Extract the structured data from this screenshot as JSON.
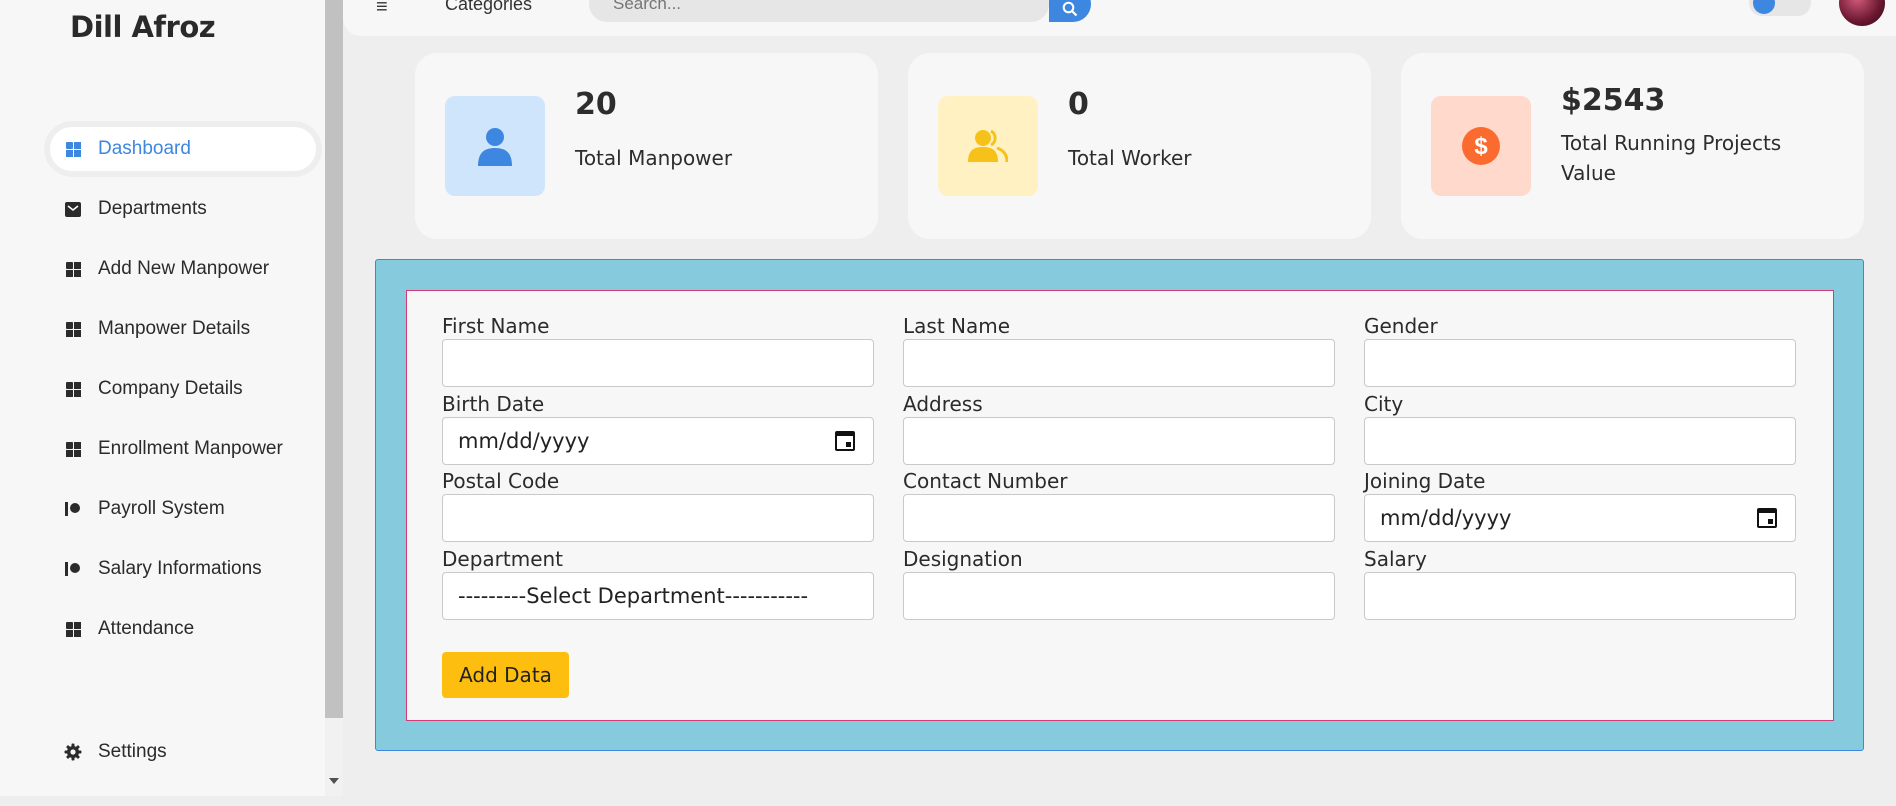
{
  "sidebar": {
    "brand": "Dill Afroz",
    "items": [
      {
        "label": "Dashboard",
        "icon": "dashboard-icon"
      },
      {
        "label": "Departments",
        "icon": "mail-icon"
      },
      {
        "label": "Add New Manpower",
        "icon": "grid-icon"
      },
      {
        "label": "Manpower Details",
        "icon": "grid-icon"
      },
      {
        "label": "Company Details",
        "icon": "grid-icon"
      },
      {
        "label": "Enrollment Manpower",
        "icon": "grid-icon"
      },
      {
        "label": "Payroll System",
        "icon": "toggle-icon"
      },
      {
        "label": "Salary Informations",
        "icon": "toggle-icon"
      },
      {
        "label": "Attendance",
        "icon": "grid-icon"
      }
    ],
    "settings_label": "Settings",
    "active_color": "#3d87e0"
  },
  "topbar": {
    "menu_icon": "≡",
    "categories_label": "Categories",
    "search_placeholder": "Search..."
  },
  "cards": [
    {
      "value": "20",
      "label": "Total Manpower",
      "icon": "user-icon",
      "color": "#3d87e0",
      "bg": "#cfe5fb"
    },
    {
      "value": "0",
      "label": "Total Worker",
      "icon": "users-icon",
      "color": "#f6c21a",
      "bg": "#fff1c2"
    },
    {
      "value": "$2543",
      "label": "Total Running Projects Value",
      "icon": "dollar-icon",
      "color": "#fb6b30",
      "bg": "#ffd9cc"
    }
  ],
  "form": {
    "first_name": {
      "label": "First Name",
      "value": ""
    },
    "last_name": {
      "label": "Last Name",
      "value": ""
    },
    "gender": {
      "label": "Gender",
      "value": ""
    },
    "birth_date": {
      "label": "Birth Date",
      "value": "mm/dd/yyyy"
    },
    "address": {
      "label": "Address",
      "value": ""
    },
    "city": {
      "label": "City",
      "value": ""
    },
    "postal_code": {
      "label": "Postal Code",
      "value": ""
    },
    "contact_number": {
      "label": "Contact Number",
      "value": ""
    },
    "joining_date": {
      "label": "Joining Date",
      "value": "mm/dd/yyyy"
    },
    "department": {
      "label": "Department",
      "value": "---------Select Department-----------"
    },
    "designation": {
      "label": "Designation",
      "value": ""
    },
    "salary": {
      "label": "Salary",
      "value": ""
    },
    "submit_label": "Add Data"
  },
  "colors": {
    "accent": "#3d87e0",
    "form_bg": "#85cbdd",
    "form_inner_border": "#d43a74",
    "button": "#fdbe10"
  }
}
